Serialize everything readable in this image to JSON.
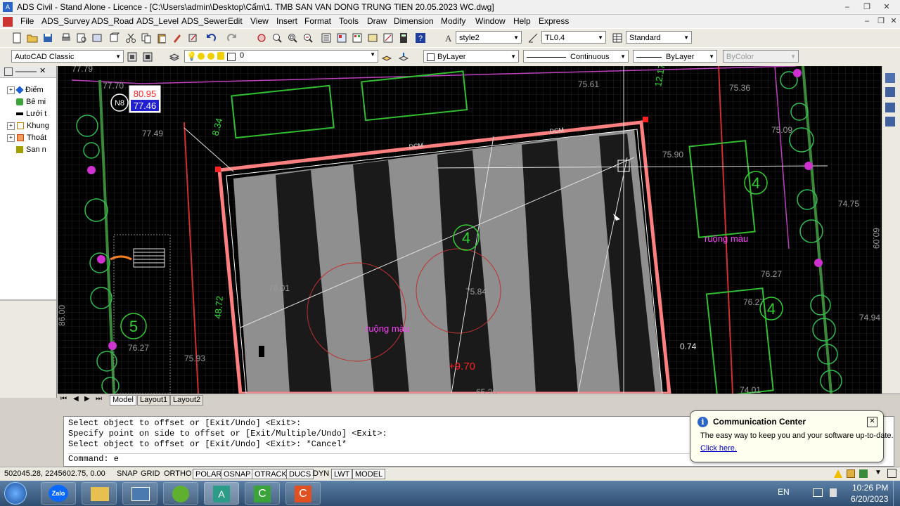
{
  "window": {
    "title": "ADS Civil - Stand Alone - Licence - [C:\\Users\\admin\\Desktop\\Cẩm\\1. TMB SAN VAN DONG TRUNG TIEN 20.05.2023 WC.dwg]",
    "min": "–",
    "max": "❐",
    "close": "✕"
  },
  "menu": {
    "items": [
      "File",
      "ADS_Survey",
      "ADS_Road",
      "ADS_Level",
      "ADS_Sewer",
      "Edit",
      "View",
      "Insert",
      "Format",
      "Tools",
      "Draw",
      "Dimension",
      "Modify",
      "Window",
      "Help",
      "Express"
    ]
  },
  "toolbar1": {
    "text_style": "style2",
    "dim_style": "TL0.4",
    "table_style": "Standard"
  },
  "toolbar2": {
    "workspace": "AutoCAD Classic",
    "layer": "0",
    "color": "ByLayer",
    "linetype": "Continuous",
    "lineweight": "ByLayer",
    "plotstyle": "ByColor"
  },
  "left_panel": {
    "items": [
      {
        "label": "Điểm",
        "color": "#1a5fd8"
      },
      {
        "label": "Bê mi",
        "color": "#3aa43a"
      },
      {
        "label": "Lưới t",
        "color": "#000000"
      },
      {
        "label": "Khung",
        "color": "#c08000"
      },
      {
        "label": "Thoát",
        "color": "#d04000"
      },
      {
        "label": "San n",
        "color": "#a0a000"
      }
    ]
  },
  "drawing": {
    "labels": {
      "n8": "N8",
      "l1": "80.95",
      "l2": "77.46",
      "l3": "77.79",
      "l4": "77.70",
      "l5": "77.49",
      "l6": "12.17",
      "l7": "75.61",
      "l8": "75.36",
      "l9": "75.09",
      "l10": "74.75",
      "l11": "76.27",
      "l12": "74.94",
      "l13": "76.27",
      "l14": "76.27",
      "l15": "75.93",
      "l16": "76.01",
      "l17": "74.01",
      "l18": "48.72",
      "l19": "8.34",
      "l20": "ruộng màu",
      "l21": "ruộng màu",
      "l22": "+9.70",
      "l23": "75.84",
      "l24": "0.74",
      "l25": "4",
      "l26": "4",
      "l27": "4",
      "l28": "5",
      "l29": "86.00",
      "l30": "60.09",
      "l31": "75.90",
      "l32": "65.20",
      "l33": "DCM"
    }
  },
  "tabs": [
    "Model",
    "Layout1",
    "Layout2"
  ],
  "command": {
    "lines": [
      "Select object to offset or [Exit/Undo] <Exit>:",
      "Specify point on side to offset or [Exit/Multiple/Undo] <Exit>:",
      "Select object to offset or [Exit/Undo] <Exit>: *Cancel*",
      "Command: e"
    ]
  },
  "status": {
    "coords": "502045.28, 2245602.75, 0.00",
    "buttons": [
      {
        "label": "SNAP",
        "on": false
      },
      {
        "label": "GRID",
        "on": false
      },
      {
        "label": "ORTHO",
        "on": false
      },
      {
        "label": "POLAR",
        "on": true
      },
      {
        "label": "OSNAP",
        "on": true
      },
      {
        "label": "OTRACK",
        "on": true
      },
      {
        "label": "DUCS",
        "on": true
      },
      {
        "label": "DYN",
        "on": false
      },
      {
        "label": "LWT",
        "on": true
      },
      {
        "label": "MODEL",
        "on": true
      }
    ]
  },
  "notification": {
    "title": "Communication Center",
    "text": "The easy way to keep you and your software up-to-date.",
    "link": "Click here."
  },
  "taskbar": {
    "lang": "EN",
    "time": "10:26 PM",
    "date": "6/20/2023",
    "zalo": "Zalo"
  }
}
